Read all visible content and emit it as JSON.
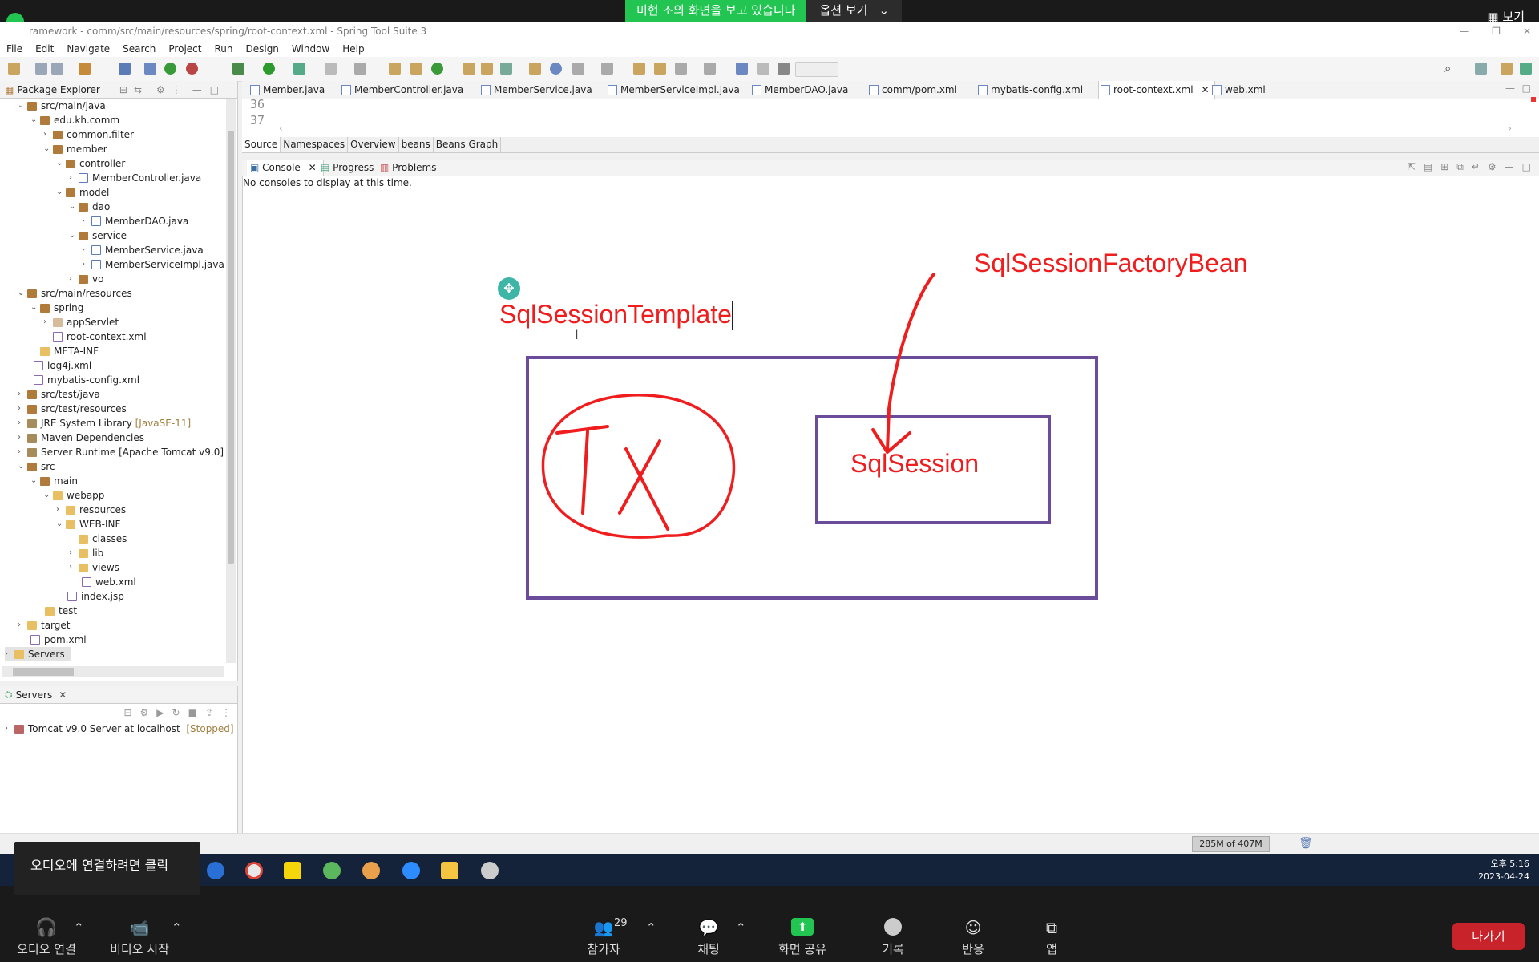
{
  "zoom": {
    "banner_text": "미현 조의 화면을 보고 있습니다",
    "banner_option": "옵션 보기",
    "view_label": "보기",
    "bottom": {
      "audio": "오디오 연결",
      "video": "비디오 시작",
      "participants": "참가자",
      "participants_count": "29",
      "chat": "채팅",
      "share": "화면 공유",
      "record": "기록",
      "reactions": "반응",
      "apps": "앱",
      "leave": "나가기"
    },
    "tooltip": "오디오에 연결하려면 클릭"
  },
  "ide": {
    "title": "ramework - comm/src/main/resources/spring/root-context.xml - Spring Tool Suite 3",
    "menu": [
      "File",
      "Edit",
      "Navigate",
      "Search",
      "Project",
      "Run",
      "Design",
      "Window",
      "Help"
    ],
    "package_explorer_tab": "Package Explorer",
    "tree": [
      "src/main/java",
      "edu.kh.comm",
      "common.filter",
      "member",
      "controller",
      "MemberController.java",
      "model",
      "dao",
      "MemberDAO.java",
      "service",
      "MemberService.java",
      "MemberServiceImpl.java",
      "vo",
      "src/main/resources",
      "spring",
      "appServlet",
      "root-context.xml",
      "META-INF",
      "log4j.xml",
      "mybatis-config.xml",
      "src/test/java",
      "src/test/resources",
      "JRE System Library",
      "[JavaSE-11]",
      "Maven Dependencies",
      "Server Runtime [Apache Tomcat v9.0]",
      "src",
      "main",
      "webapp",
      "resources",
      "WEB-INF",
      "classes",
      "lib",
      "views",
      "web.xml",
      "index.jsp",
      "test",
      "target",
      "pom.xml",
      "Servers"
    ],
    "servers_tab": "Servers",
    "server_entry": "Tomcat v9.0 Server at localhost",
    "server_status": "[Stopped]",
    "editor_tabs": [
      "Member.java",
      "MemberController.java",
      "MemberService.java",
      "MemberServiceImpl.java",
      "MemberDAO.java",
      "comm/pom.xml",
      "mybatis-config.xml",
      "root-context.xml",
      "web.xml"
    ],
    "line_numbers": [
      "36",
      "37"
    ],
    "source_tabs": [
      "Source",
      "Namespaces",
      "Overview",
      "beans",
      "Beans Graph"
    ],
    "console_tabs": [
      "Console",
      "Progress",
      "Problems"
    ],
    "console_message": "No consoles to display at this time.",
    "memory": "285M of 407M"
  },
  "annotation": {
    "template_label": "SqlSessionTemplate",
    "factory_label": "SqlSessionFactoryBean",
    "session_label": "SqlSession",
    "tx_label": "TX"
  },
  "clock": {
    "time": "오후 5:16",
    "date": "2023-04-24"
  },
  "colors": {
    "ink_red": "#ef1d1d",
    "box_purple": "#6b4c9a",
    "zoom_green": "#23c552",
    "leave_red": "#c8232a"
  }
}
